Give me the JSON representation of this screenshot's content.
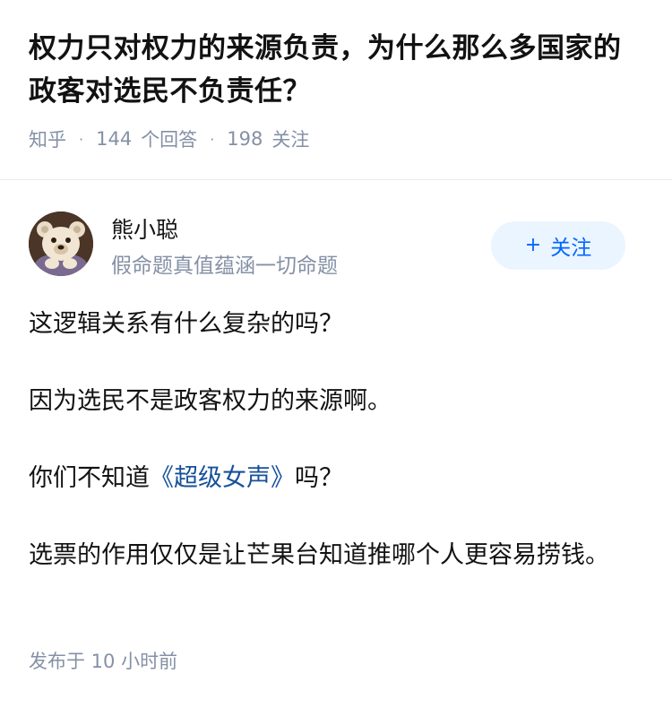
{
  "question": {
    "title": "权力只对权力的来源负责，为什么那么多国家的政客对选民不负责任？",
    "source": "知乎",
    "answers_count": "144",
    "answers_label": "个回答",
    "followers_count": "198",
    "followers_label": "关注"
  },
  "author": {
    "name": "熊小聪",
    "bio": "假命题真值蕴涵一切命题",
    "avatar_icon": "teddy-bear-avatar",
    "follow_plus": "+",
    "follow_label": "关注"
  },
  "answer": {
    "p1": "这逻辑关系有什么复杂的吗？",
    "p2": "因为选民不是政客权力的来源啊。",
    "p3_before": "你们不知道",
    "p3_link": "《超级女声》",
    "p3_after": "吗？",
    "p4": "选票的作用仅仅是让芒果台知道推哪个人更容易捞钱。",
    "published": "发布于  10 小时前"
  },
  "colors": {
    "link": "#175199",
    "accent": "#0066ff",
    "meta_gray": "#8590a6"
  }
}
